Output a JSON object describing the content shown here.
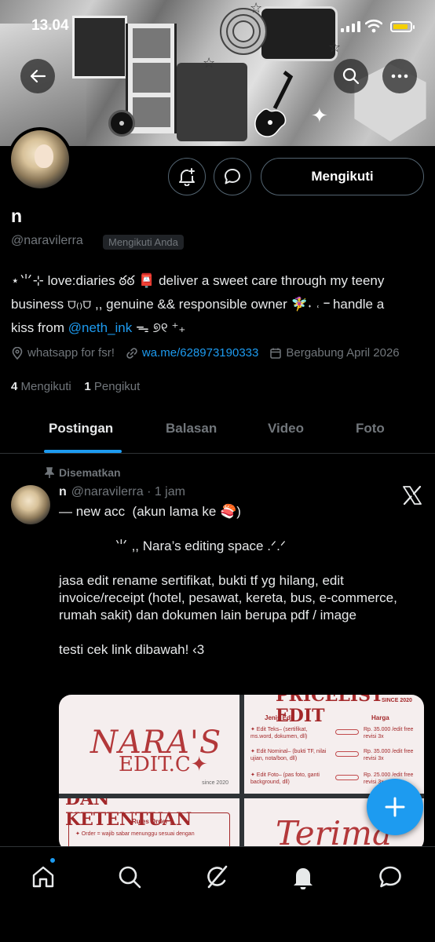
{
  "status_bar": {
    "time": "13.04"
  },
  "profile": {
    "display_name": "n",
    "handle": "@naravilerra",
    "follows_you_badge": "Mengikuti Anda",
    "follow_button_label": "Mengikuti",
    "bio_line1": "⋆⺌⊹ love:diaries ఠఠ 📮 deliver a sweet care through my teeny",
    "bio_line2": "business ⩌₍₎⩌ ,, genuine && responsible owner 🧚‍♀️˖ ˓ ᠆ handle a",
    "bio_line3_pre": "kiss from ",
    "bio_link": "@neth_ink",
    "bio_line3_post": " ᯓ ୭୧ ⁺₊",
    "location_text": "whatsapp for fsr!",
    "website": "wa.me/628973190333",
    "joined": "Bergabung April 2026",
    "following_count": "4",
    "following_label": "Mengikuti",
    "followers_count": "1",
    "followers_label": "Pengikut"
  },
  "tabs": [
    {
      "label": "Postingan",
      "active": true
    },
    {
      "label": "Balasan",
      "active": false
    },
    {
      "label": "Video",
      "active": false
    },
    {
      "label": "Foto",
      "active": false
    }
  ],
  "post": {
    "pinned_label": "Disematkan",
    "author_name": "n",
    "author_handle": "@naravilerra",
    "time": "· 1 jam",
    "text": "— new acc  (akun lama ke 🍣)\n\n               ⺌ ,, Nara’s editing space .ᐟ.ᐟ\n\njasa edit rename sertifikat, bukti tf yg hilang, edit invoice/receipt (hotel, pesawat, kereta, bus, e-commerce, rumah sakit) dan dokumen lain berupa pdf / image\n\ntesti cek link dibawah! ‹3",
    "media": {
      "img1_brand": "NARA'S",
      "img1_sub": "EDIT.C✦",
      "img1_since": "since 2020",
      "img2_title": "PRICELIST EDIT",
      "img2_since": "SINCE 2020",
      "img2_col1": "Jenis Edit",
      "img2_col2": "Harga",
      "img2_rows": [
        {
          "item": "✦ Edit Teks– (sertifikat, ms.word, dokumen, dll)",
          "price": "Rp. 35.000 /edit free revisi 3x"
        },
        {
          "item": "✦ Edit Nominal– (bukti TF, nilai ujian, nota/bon, dll)",
          "price": "Rp. 35.000 /edit free revisi 3x"
        },
        {
          "item": "✦ Edit Foto– (pas foto, ganti background, dll)",
          "price": "Rp. 25.000 /edit free revisi 3x"
        }
      ],
      "img3_title": "DAN KETENTUAN",
      "img3_box_title": "Rules Order :",
      "img3_box_line": "✦ Order = wajib sabar menunggu sesuai dengan",
      "img4_text": "Terima"
    }
  },
  "colors": {
    "accent": "#1d9bf0",
    "background": "#000000",
    "muted": "#71767b",
    "text": "#e7e9ea"
  },
  "icons": [
    "back-arrow-icon",
    "search-icon",
    "more-icon",
    "notification-add-icon",
    "message-icon",
    "location-icon",
    "link-icon",
    "calendar-icon",
    "pin-icon",
    "x-logo-icon",
    "plus-icon",
    "home-icon",
    "explore-icon",
    "grok-icon",
    "bell-icon",
    "messages-icon"
  ]
}
